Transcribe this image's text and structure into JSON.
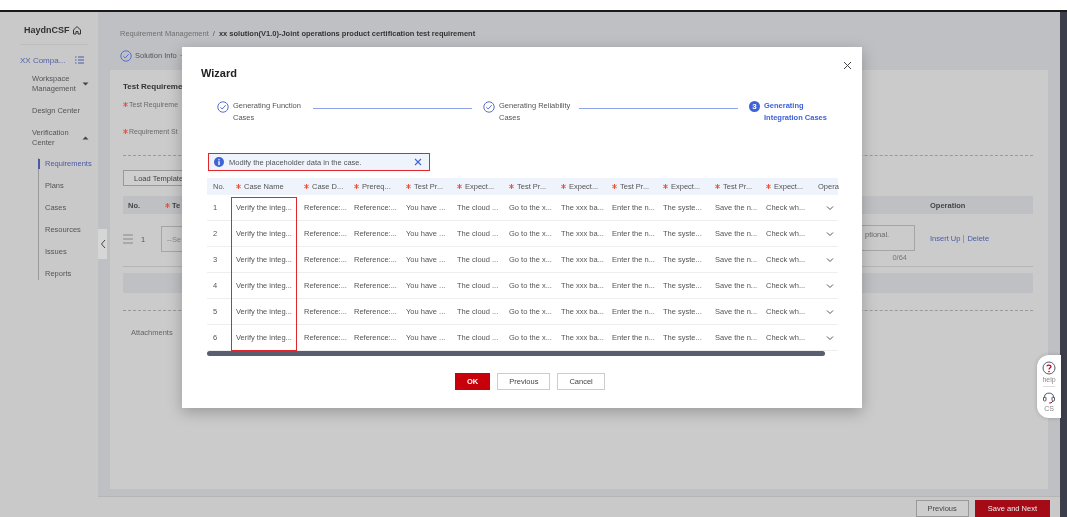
{
  "sidebar": {
    "brand": "HaydnCSF",
    "tenant": "XX Compa...",
    "items": [
      {
        "label": "Workspace Management",
        "expanded": false
      },
      {
        "label": "Design Center"
      },
      {
        "label": "Verification Center",
        "expanded": true,
        "children": [
          {
            "label": "Requirements",
            "selected": true
          },
          {
            "label": "Plans",
            "selected": false
          },
          {
            "label": "Cases",
            "selected": false
          },
          {
            "label": "Resources",
            "selected": false
          },
          {
            "label": "Issues",
            "selected": false
          },
          {
            "label": "Reports",
            "selected": false
          }
        ]
      }
    ]
  },
  "breadcrumb": {
    "parent": "Requirement Management",
    "separator": "/",
    "current": "xx solution(V1.0)-Joint operations product certification test requirement"
  },
  "progress_steps": [
    {
      "label": "Solution Info",
      "done": true
    }
  ],
  "form": {
    "title": "Test Requireme",
    "fields": [
      {
        "label": "Test Requireme",
        "required": true
      },
      {
        "label": "Requirement St",
        "required": true
      }
    ],
    "load_template": "Load Template",
    "table": {
      "columns": [
        {
          "label": "No.",
          "required": false
        },
        {
          "label": "Te",
          "required": true
        },
        {
          "label": "Operation",
          "required": false
        }
      ],
      "rows": [
        {
          "no": "1",
          "select": {
            "placeholder": "--Se"
          },
          "description": {
            "placeholder": "ptional.",
            "counter": "0/64"
          },
          "actions": [
            "Insert Up",
            "Delete"
          ]
        }
      ]
    },
    "attachments": "Attachments"
  },
  "footer_buttons": [
    {
      "label": "Previous",
      "kind": "secondary"
    },
    {
      "label": "Save and Next",
      "kind": "primary"
    }
  ],
  "float_tools": [
    {
      "label": "help",
      "kind": "help"
    },
    {
      "label": "CS",
      "kind": "cs"
    }
  ],
  "dialog": {
    "title": "Wizard",
    "steps": [
      {
        "label": "Generating Function Cases",
        "done": true,
        "active": false
      },
      {
        "label": "Generating Reliability Cases",
        "done": true,
        "active": false
      },
      {
        "number": "3",
        "label": "Generating Integration Cases",
        "done": false,
        "active": true
      }
    ],
    "alert": {
      "text": "Modify the placeholder data in the case.",
      "highlighted": true
    },
    "table": {
      "columns": [
        {
          "label": "No.",
          "required": false,
          "highlighted": false
        },
        {
          "label": "Case Name",
          "required": true,
          "highlighted": true
        },
        {
          "label": "Case D...",
          "required": true,
          "highlighted": false
        },
        {
          "label": "Prereq...",
          "required": true,
          "highlighted": false
        },
        {
          "label": "Test Pr...",
          "required": true,
          "highlighted": false
        },
        {
          "label": "Expect...",
          "required": true,
          "highlighted": false
        },
        {
          "label": "Test Pr...",
          "required": true,
          "highlighted": false
        },
        {
          "label": "Expect...",
          "required": true,
          "highlighted": false
        },
        {
          "label": "Test Pr...",
          "required": true,
          "highlighted": false
        },
        {
          "label": "Expect...",
          "required": true,
          "highlighted": false
        },
        {
          "label": "Test Pr...",
          "required": true,
          "highlighted": false
        },
        {
          "label": "Expect...",
          "required": true,
          "highlighted": false
        },
        {
          "label": "Opera",
          "required": false,
          "highlighted": false
        }
      ],
      "rows": [
        {
          "cells": [
            "1",
            "Verify the integ...",
            "Reference:...",
            "Reference:...",
            "You have ...",
            "The cloud ...",
            "Go to the x...",
            "The xxx ba...",
            "Enter the n...",
            "The syste...",
            "Save the n...",
            "Check wh..."
          ],
          "expanded": false
        },
        {
          "cells": [
            "2",
            "Verify the integ...",
            "Reference:...",
            "Reference:...",
            "You have ...",
            "The cloud ...",
            "Go to the x...",
            "The xxx ba...",
            "Enter the n...",
            "The syste...",
            "Save the n...",
            "Check wh..."
          ],
          "expanded": false
        },
        {
          "cells": [
            "3",
            "Verify the integ...",
            "Reference:...",
            "Reference:...",
            "You have ...",
            "The cloud ...",
            "Go to the x...",
            "The xxx ba...",
            "Enter the n...",
            "The syste...",
            "Save the n...",
            "Check wh..."
          ],
          "expanded": false
        },
        {
          "cells": [
            "4",
            "Verify the integ...",
            "Reference:...",
            "Reference:...",
            "You have ...",
            "The cloud ...",
            "Go to the x...",
            "The xxx ba...",
            "Enter the n...",
            "The syste...",
            "Save the n...",
            "Check wh..."
          ],
          "expanded": false
        },
        {
          "cells": [
            "5",
            "Verify the integ...",
            "Reference:...",
            "Reference:...",
            "You have ...",
            "The cloud ...",
            "Go to the x...",
            "The xxx ba...",
            "Enter the n...",
            "The syste...",
            "Save the n...",
            "Check wh..."
          ],
          "expanded": false
        },
        {
          "cells": [
            "6",
            "Verify the integ...",
            "Reference:...",
            "Reference:...",
            "You have ...",
            "The cloud ...",
            "Go to the x...",
            "The xxx ba...",
            "Enter the n...",
            "The syste...",
            "Save the n...",
            "Check wh..."
          ],
          "expanded": false
        }
      ]
    },
    "buttons": [
      {
        "label": "OK",
        "kind": "primary"
      },
      {
        "label": "Previous",
        "kind": "secondary"
      },
      {
        "label": "Cancel",
        "kind": "secondary"
      }
    ]
  }
}
